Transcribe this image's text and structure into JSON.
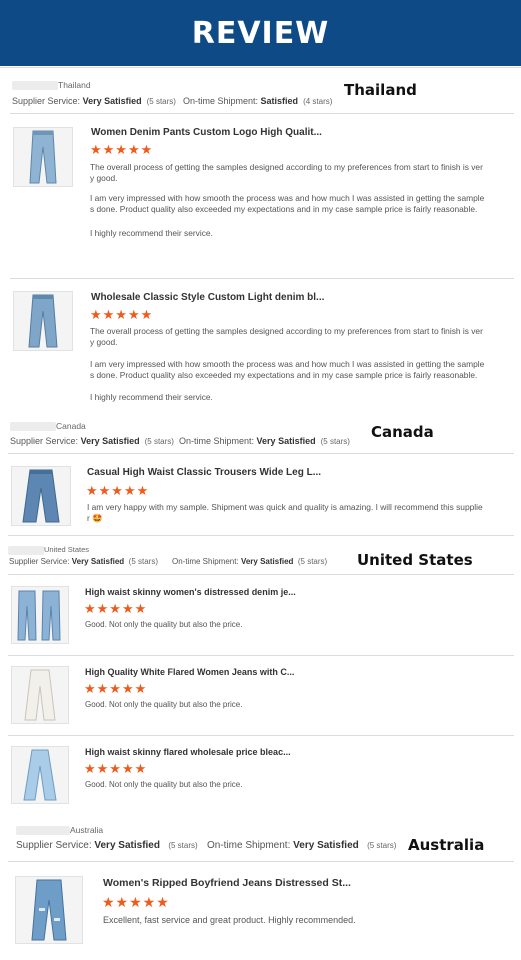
{
  "banner": {
    "title": "REVIEW"
  },
  "colors": {
    "banner": "#0e4a86",
    "star": "#f05a1a"
  },
  "reviews": [
    {
      "location": "Thailand",
      "supplier_label": "Supplier Service:",
      "supplier_value": "Very Satisfied",
      "supplier_stars": "(5 stars)",
      "shipment_label": "On-time Shipment:",
      "shipment_value": "Satisfied",
      "shipment_stars": "(4 stars)",
      "country_tag": "Thailand",
      "products": [
        {
          "title": "Women Denim Pants Custom Logo High Qualit...",
          "stars": "★★★★★",
          "p1": "The overall process of getting the samples designed according to my preferences from start to finish is ver y good.",
          "p2": "I am very impressed with how smooth the process was and how much I was assisted in getting the sample s done. Product quality also exceeded my expectations and in my case sample price is fairly reasonable.",
          "p3": "I highly recommend their service."
        },
        {
          "title": "Wholesale Classic Style Custom Light denim bl...",
          "stars": "★★★★★",
          "p1": "The overall process of getting the samples designed according to my preferences from start to finish is ver y good.",
          "p2": "I am very impressed with how smooth the process was and how much I was assisted in getting the sample s done. Product quality also exceeded my expectations and in my case sample price is fairly reasonable.",
          "p3": "I highly recommend their service."
        }
      ]
    },
    {
      "location": "Canada",
      "supplier_label": "Supplier Service:",
      "supplier_value": "Very Satisfied",
      "supplier_stars": "(5 stars)",
      "shipment_label": "On-time Shipment:",
      "shipment_value": "Very Satisfied",
      "shipment_stars": "(5 stars)",
      "country_tag": "Canada",
      "products": [
        {
          "title": "Casual High Waist Classic Trousers Wide Leg L...",
          "stars": "★★★★★",
          "p1": "I am very happy with my sample. Shipment was quick and quality is amazing. I will recommend this supplie r 🤩"
        }
      ]
    },
    {
      "location": "United States",
      "supplier_label": "Supplier Service:",
      "supplier_value": "Very Satisfied",
      "supplier_stars": "(5 stars)",
      "shipment_label": "On-time Shipment:",
      "shipment_value": "Very Satisfied",
      "shipment_stars": "(5 stars)",
      "country_tag": "United States",
      "products": [
        {
          "title": "High waist skinny women's distressed denim je...",
          "stars": "★★★★★",
          "p1": "Good. Not only the quality but also the price."
        },
        {
          "title": "High Quality White Flared Women Jeans with C...",
          "stars": "★★★★★",
          "p1": "Good. Not only the quality but also the price."
        },
        {
          "title": "High waist skinny flared wholesale price bleac...",
          "stars": "★★★★★",
          "p1": "Good. Not only the quality but also the price."
        }
      ]
    },
    {
      "location": "Australia",
      "supplier_label": "Supplier Service:",
      "supplier_value": "Very Satisfied",
      "supplier_stars": "(5 stars)",
      "shipment_label": "On-time Shipment:",
      "shipment_value": "Very Satisfied",
      "shipment_stars": "(5 stars)",
      "country_tag": "Australia",
      "products": [
        {
          "title": "Women's Ripped Boyfriend Jeans Distressed St...",
          "stars": "★★★★★",
          "p1": "Excellent, fast service and great product.  Highly recommended."
        }
      ]
    }
  ]
}
